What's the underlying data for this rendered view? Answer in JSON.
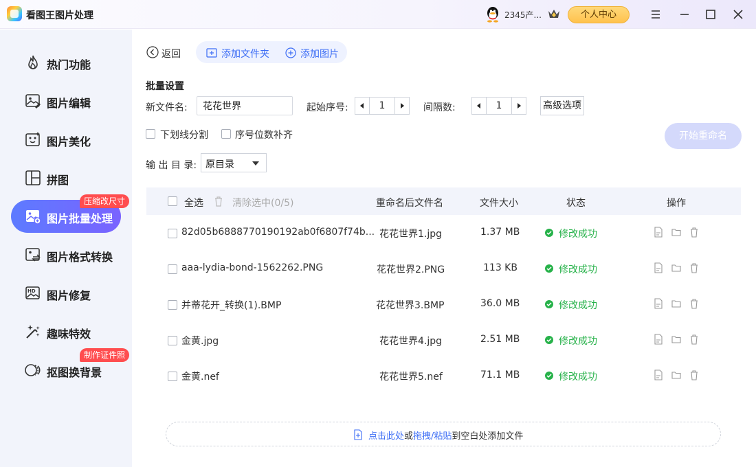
{
  "app": {
    "title": "看图王图片处理",
    "user_name": "2345产...",
    "center_button": "个人中心"
  },
  "sidebar": {
    "items": [
      {
        "label": "热门功能",
        "icon": "flame-icon"
      },
      {
        "label": "图片编辑",
        "icon": "image-edit-icon"
      },
      {
        "label": "图片美化",
        "icon": "image-beautify-icon"
      },
      {
        "label": "拼图",
        "icon": "collage-icon"
      },
      {
        "label": "图片批量处理",
        "icon": "batch-image-icon",
        "badge": "压缩改尺寸",
        "active": true
      },
      {
        "label": "图片格式转换",
        "icon": "format-convert-icon"
      },
      {
        "label": "图片修复",
        "icon": "hd-repair-icon"
      },
      {
        "label": "趣味特效",
        "icon": "magic-effect-icon"
      },
      {
        "label": "抠图换背景",
        "icon": "cutout-icon",
        "badge": "制作证件照"
      }
    ]
  },
  "toolbar": {
    "back": "返回",
    "add_folder": "添加文件夹",
    "add_image": "添加图片"
  },
  "settings": {
    "title": "批量设置",
    "new_name_label": "新文件名:",
    "new_name_value": "花花世界",
    "start_label": "起始序号:",
    "start_value": "1",
    "interval_label": "间隔数:",
    "interval_value": "1",
    "advanced": "高级选项",
    "underscore": "下划线分割",
    "pad_digits": "序号位数补齐",
    "start_button": "开始重命名",
    "output_label": "输 出 目 录:",
    "output_value": "原目录"
  },
  "table": {
    "select_all": "全选",
    "clear_selected": "清除选中(0/5)",
    "columns": {
      "renamed": "重命名后文件名",
      "size": "文件大小",
      "status": "状态",
      "ops": "操作"
    },
    "rows": [
      {
        "name": "82d05b6888770190192ab0f6807f74b...",
        "renamed": "花花世界1.jpg",
        "size": "1.37 MB",
        "status": "修改成功"
      },
      {
        "name": "aaa-lydia-bond-1562262.PNG",
        "renamed": "花花世界2.PNG",
        "size": "113 KB",
        "status": "修改成功"
      },
      {
        "name": "并蒂花开_转换(1).BMP",
        "renamed": "花花世界3.BMP",
        "size": "36.0 MB",
        "status": "修改成功"
      },
      {
        "name": "金黄.jpg",
        "renamed": "花花世界4.jpg",
        "size": "2.51 MB",
        "status": "修改成功"
      },
      {
        "name": "金黄.nef",
        "renamed": "花花世界5.nef",
        "size": "71.1 MB",
        "status": "修改成功"
      }
    ]
  },
  "dropzone": {
    "click_here": "点击此处",
    "or": "或",
    "drag_paste": "拖拽/粘贴",
    "rest": "到空白处添加文件"
  },
  "colors": {
    "accent": "#3b6cf5",
    "success": "#27b24a",
    "badge": "#ff4d4f",
    "active_nav": "#6a70ff"
  }
}
